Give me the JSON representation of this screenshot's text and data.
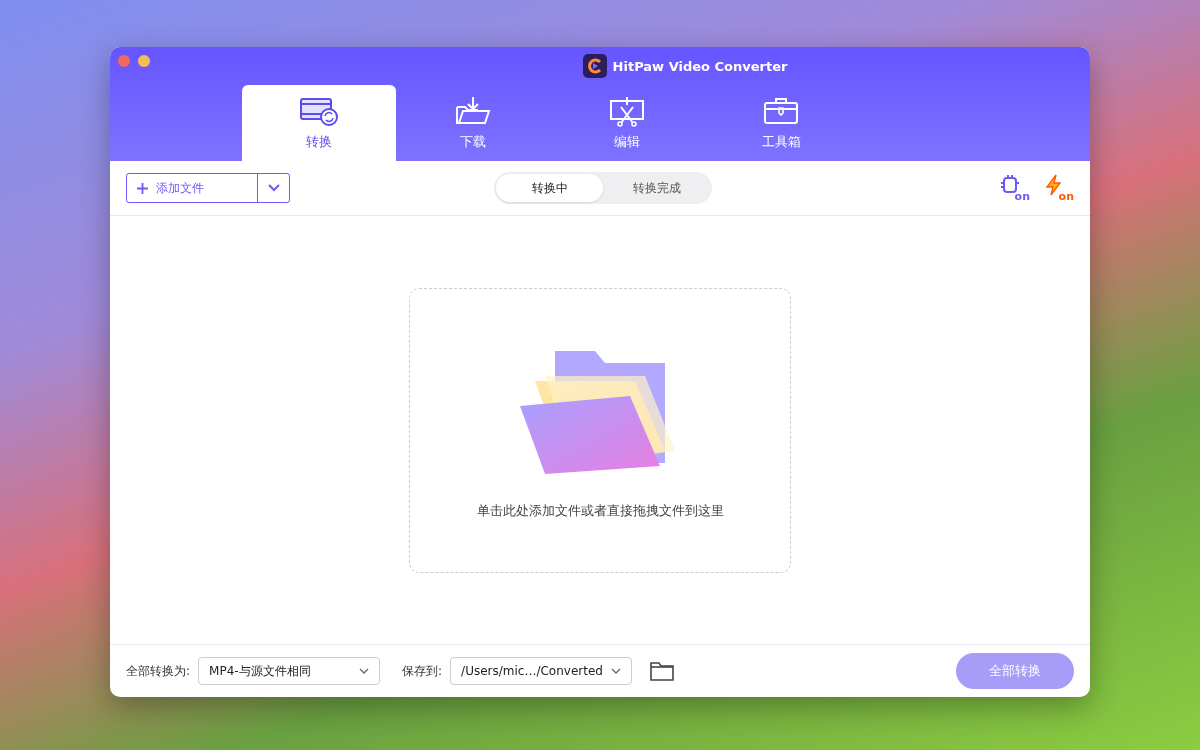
{
  "window": {
    "title": "HitPaw Video Converter"
  },
  "tabs": [
    {
      "label": "转换",
      "kind": "convert",
      "selected": true
    },
    {
      "label": "下载",
      "kind": "download",
      "selected": false
    },
    {
      "label": "编辑",
      "kind": "edit",
      "selected": false
    },
    {
      "label": "工具箱",
      "kind": "toolbox",
      "selected": false
    }
  ],
  "toolbar": {
    "add_button": "添加文件",
    "segments": [
      {
        "label": "转换中",
        "selected": true
      },
      {
        "label": "转换完成",
        "selected": false
      }
    ],
    "toggles": [
      {
        "kind": "hardware",
        "badge": "on"
      },
      {
        "kind": "speed",
        "badge": "on"
      }
    ]
  },
  "drop_zone": {
    "hint": "单击此处添加文件或者直接拖拽文件到这里"
  },
  "footer": {
    "format_label": "全部转换为:",
    "format_value": "MP4-与源文件相同",
    "save_label": "保存到:",
    "save_value": "/Users/mic…/Converted",
    "convert_button": {
      "label": "全部转换",
      "disabled": true
    }
  }
}
